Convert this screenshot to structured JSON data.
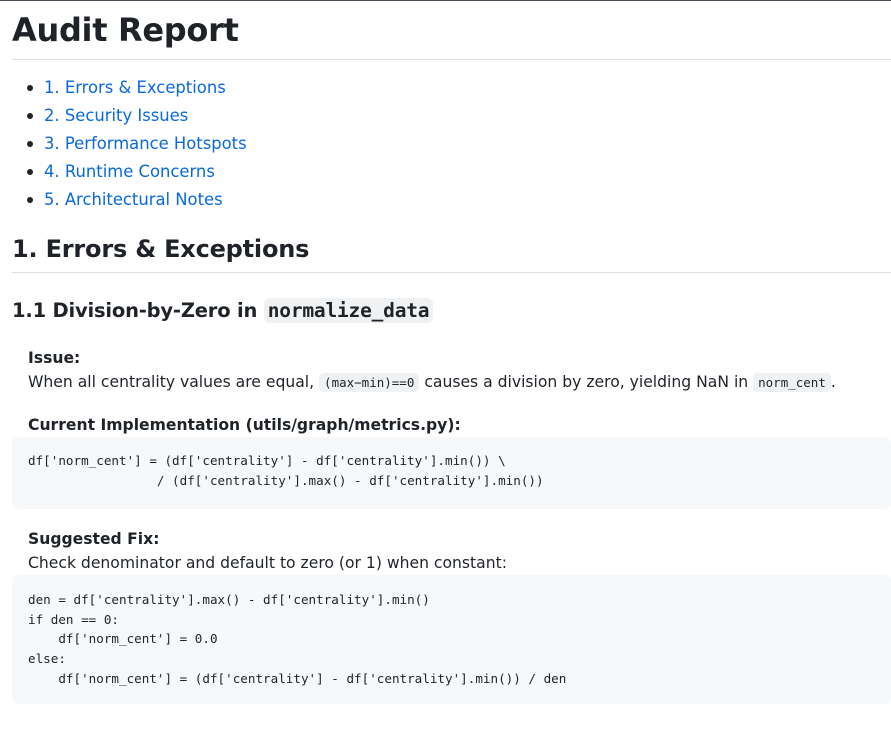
{
  "title": "Audit Report",
  "toc": [
    "1. Errors & Exceptions",
    "2. Security Issues",
    "3. Performance Hotspots",
    "4. Runtime Concerns",
    "5. Architectural Notes"
  ],
  "section1": {
    "heading": "1. Errors & Exceptions",
    "sub1": {
      "heading_prefix": "1.1 Division-by-Zero in ",
      "heading_code": "normalize_data",
      "issue_label": "Issue:",
      "issue_text_1": "When all centrality values are equal, ",
      "issue_code_1": "(max−min)==0",
      "issue_text_2": " causes a division by zero, yielding NaN in ",
      "issue_code_2": "norm_cent",
      "issue_text_3": ".",
      "current_label": "Current Implementation (utils/graph/metrics.py):",
      "current_code": "df['norm_cent'] = (df['centrality'] - df['centrality'].min()) \\\n                 / (df['centrality'].max() - df['centrality'].min())",
      "fix_label": "Suggested Fix:",
      "fix_text": "Check denominator and default to zero (or 1) when constant:",
      "fix_code": "den = df['centrality'].max() - df['centrality'].min()\nif den == 0:\n    df['norm_cent'] = 0.0\nelse:\n    df['norm_cent'] = (df['centrality'] - df['centrality'].min()) / den"
    }
  }
}
